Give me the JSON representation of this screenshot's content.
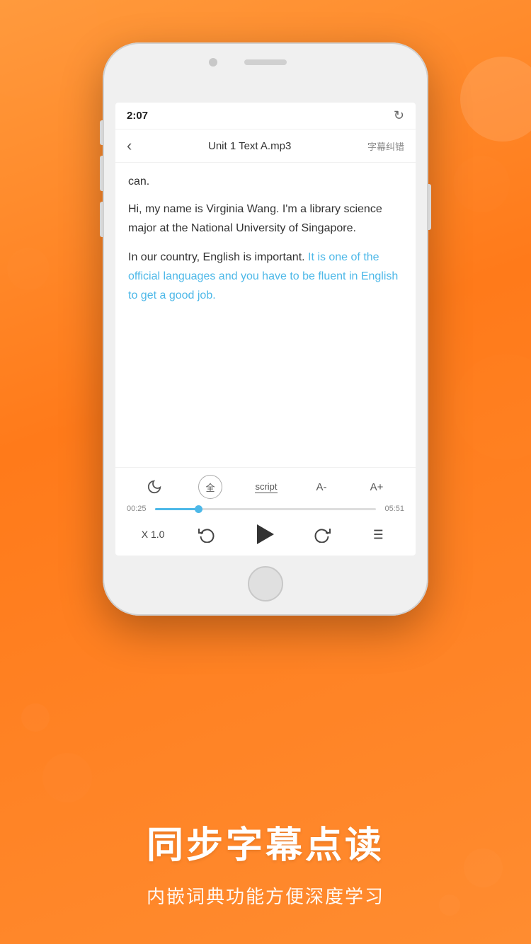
{
  "background": {
    "color_start": "#FF9A3C",
    "color_end": "#FF7A1A"
  },
  "phone": {
    "time": "2:07",
    "refresh_icon": "↻",
    "nav": {
      "back_label": "‹",
      "title": "Unit 1 Text A.mp3",
      "error_label": "字幕纠错"
    },
    "content": {
      "line1": "can.",
      "paragraph1": "Hi, my name is Virginia Wang. I'm a library science major at the National University of Singapore.",
      "paragraph2_prefix": "In our country, English is important. ",
      "paragraph2_highlight": "It is one of the official languages and you have to be fluent in English to get a good job.",
      "paragraph2_suffix": ""
    },
    "controls": {
      "night_icon": "🌙",
      "full_icon": "全",
      "script_label": "script",
      "font_minus": "A-",
      "font_plus": "A+",
      "time_current": "00:25",
      "time_total": "05:51",
      "speed_label": "X 1.0",
      "list_icon": "≡"
    }
  },
  "bottom": {
    "main_title": "同步字幕点读",
    "sub_title": "内嵌词典功能方便深度学习"
  }
}
